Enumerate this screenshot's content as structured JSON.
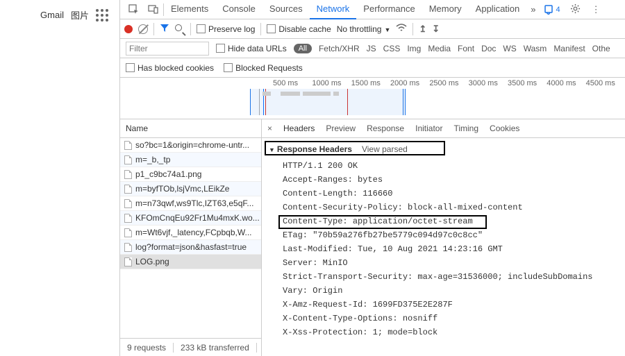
{
  "browser": {
    "gmail": "Gmail",
    "images": "图片"
  },
  "top_tabs": [
    "Elements",
    "Console",
    "Sources",
    "Network",
    "Performance",
    "Memory",
    "Application"
  ],
  "top_active": 3,
  "issues_count": "4",
  "toolbar": {
    "preserve_log": "Preserve log",
    "disable_cache": "Disable cache",
    "throttling": "No throttling"
  },
  "filter": {
    "placeholder": "Filter",
    "hide_data_urls": "Hide data URLs",
    "all_pill": "All",
    "types": [
      "Fetch/XHR",
      "JS",
      "CSS",
      "Img",
      "Media",
      "Font",
      "Doc",
      "WS",
      "Wasm",
      "Manifest",
      "Othe"
    ]
  },
  "options": {
    "blocked_cookies": "Has blocked cookies",
    "blocked_requests": "Blocked Requests"
  },
  "timeline_labels": [
    "500 ms",
    "1000 ms",
    "1500 ms",
    "2000 ms",
    "2500 ms",
    "3000 ms",
    "3500 ms",
    "4000 ms",
    "4500 ms"
  ],
  "requests": {
    "header": "Name",
    "items": [
      "so?bc=1&origin=chrome-untr...",
      "m=_b,_tp",
      "p1_c9bc74a1.png",
      "m=byfTOb,lsjVmc,LEikZe",
      "m=n73qwf,ws9Tlc,IZT63,e5qF...",
      "KFOmCnqEu92Fr1Mu4mxK.wo...",
      "m=Wt6vjf,_latency,FCpbqb,W...",
      "log?format=json&hasfast=true",
      "LOG.png"
    ],
    "selected": 8,
    "status_reqs": "9 requests",
    "status_transfer": "233 kB transferred"
  },
  "detail": {
    "tabs": [
      "Headers",
      "Preview",
      "Response",
      "Initiator",
      "Timing",
      "Cookies"
    ],
    "active_tab": 0,
    "section_title": "Response Headers",
    "view_parsed": "View parsed",
    "headers": [
      "HTTP/1.1 200 OK",
      "Accept-Ranges: bytes",
      "Content-Length: 116660",
      "Content-Security-Policy: block-all-mixed-content",
      "Content-Type: application/octet-stream",
      "ETag: \"70b59a276fb27be5779c094d97c0c8cc\"",
      "Last-Modified: Tue, 10 Aug 2021 14:23:16 GMT",
      "Server: MinIO",
      "Strict-Transport-Security: max-age=31536000; includeSubDomains",
      "Vary: Origin",
      "X-Amz-Request-Id: 1699FD375E2E287F",
      "X-Content-Type-Options: nosniff",
      "X-Xss-Protection: 1; mode=block"
    ]
  }
}
